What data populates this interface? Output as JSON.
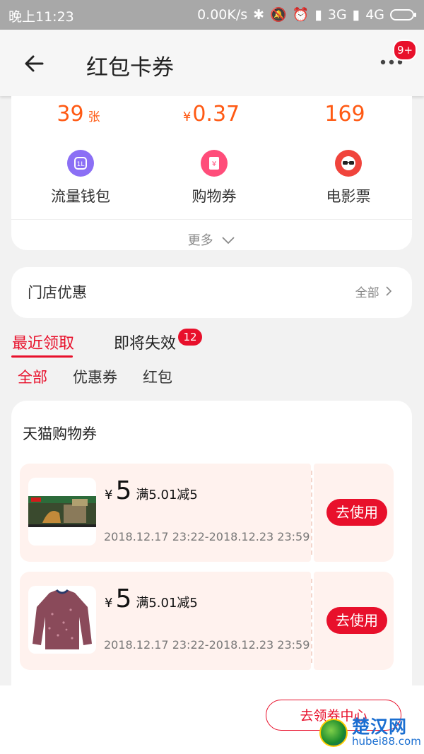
{
  "status_bar": {
    "time": "晚上11:23",
    "speed": "0.00K/s",
    "network_3g": "3G",
    "network_4g": "4G"
  },
  "header": {
    "title": "红包卡券",
    "notification_badge": "9+"
  },
  "stats": [
    {
      "value": "39",
      "unit": "张"
    },
    {
      "currency": "¥",
      "value": "0.37"
    },
    {
      "value": "169"
    }
  ],
  "categories": [
    {
      "label": "流量钱包",
      "icon": "data-wallet-icon",
      "color": "#8b6ff5"
    },
    {
      "label": "购物券",
      "icon": "shopping-coupon-icon",
      "color": "#ff4d7a"
    },
    {
      "label": "电影票",
      "icon": "movie-ticket-icon",
      "color": "#f0443c"
    }
  ],
  "more_label": "更多",
  "store": {
    "title": "门店优惠",
    "all_label": "全部"
  },
  "tabs": [
    {
      "label": "最近领取"
    },
    {
      "label": "即将失效",
      "badge": "12"
    }
  ],
  "subtabs": [
    "全部",
    "优惠券",
    "红包"
  ],
  "section_title": "天猫购物券",
  "coupons": [
    {
      "currency": "¥",
      "amount": "5",
      "condition": "满5.01减5",
      "period": "2018.12.17 23:22-2018.12.23 23:59",
      "button": "去使用",
      "thumb": "lego-box-icon"
    },
    {
      "currency": "¥",
      "amount": "5",
      "condition": "满5.01减5",
      "period": "2018.12.17 23:22-2018.12.23 23:59",
      "button": "去使用",
      "thumb": "sweater-icon"
    }
  ],
  "coupon_center_button": "去领券中心",
  "watermark": {
    "text": "楚汉网",
    "domain": "hubei88.com"
  },
  "colors": {
    "accent": "#e8102b",
    "orange": "#ff5a14"
  }
}
